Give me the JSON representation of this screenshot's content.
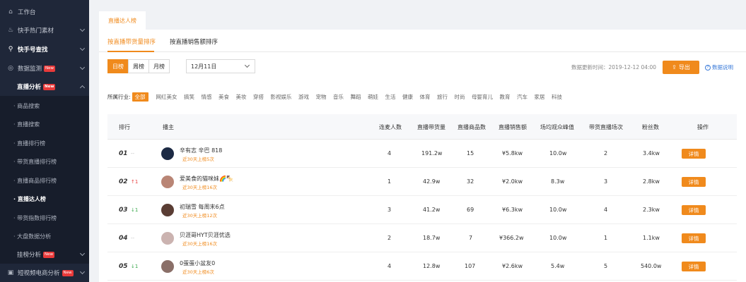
{
  "sidebar": {
    "items": [
      {
        "label": "工作台",
        "icon": "home-icon"
      },
      {
        "label": "快手热门素材",
        "icon": "fire-icon"
      },
      {
        "label": "快手号查找",
        "icon": "search-icon"
      },
      {
        "label": "数据监测",
        "icon": "monitor-icon",
        "badge": "New"
      },
      {
        "label": "直播分析",
        "badge": "New"
      }
    ],
    "sub_items": [
      {
        "label": "· 商品搜索"
      },
      {
        "label": "· 直播搜索"
      },
      {
        "label": "· 直播排行榜"
      },
      {
        "label": "· 带货直播排行榜"
      },
      {
        "label": "· 直播商品排行榜"
      },
      {
        "label": "· 直播达人榜"
      },
      {
        "label": "· 带货指数排行榜"
      },
      {
        "label": "· 大盘数据分析"
      }
    ],
    "bottom_items": [
      {
        "label": "挂榜分析",
        "badge": "New"
      },
      {
        "label": "短视频电商分析",
        "icon": "video-icon",
        "badge": "New"
      }
    ]
  },
  "page_tab": "直播达人榜",
  "subtabs": [
    "按直播带货量排序",
    "按直播销售额排序"
  ],
  "period_buttons": [
    "日榜",
    "周榜",
    "月榜"
  ],
  "date_select": "12月11日",
  "update_time": "数据更新时间：2019-12-12 04:00",
  "export_label": "导出",
  "help_label": "数据说明",
  "industry": {
    "label": "所属行业:",
    "options": [
      "全部",
      "网红美女",
      "搞笑",
      "情感",
      "美食",
      "美妆",
      "穿搭",
      "影视娱乐",
      "游戏",
      "宠物",
      "音乐",
      "舞蹈",
      "萌娃",
      "生活",
      "健康",
      "体育",
      "旅行",
      "时尚",
      "母婴育儿",
      "教育",
      "汽车",
      "家居",
      "科技"
    ]
  },
  "table": {
    "headers": [
      "排行",
      "播主",
      "连麦人数",
      "直播带货量",
      "直播商品数",
      "直播销售额",
      "场均观众峰值",
      "带货直播场次",
      "粉丝数",
      "操作"
    ],
    "rows": [
      {
        "rank": "01",
        "trend": "--",
        "trend_type": "flat",
        "name": "辛有志 辛巴 818",
        "note": "近30天上榜5次",
        "lianmai": "4",
        "sales_volume": "191.2w",
        "goods": "15",
        "revenue": "¥5.8kw",
        "peak": "10.0w",
        "sessions": "2",
        "fans": "3.4kw",
        "action": "详情",
        "avatar_color": "#1c2a44"
      },
      {
        "rank": "02",
        "trend": "↑1",
        "trend_type": "up",
        "name": "爱美食的猫咪妹🌈🍢",
        "note": "近30天上榜16次",
        "lianmai": "1",
        "sales_volume": "42.9w",
        "goods": "32",
        "revenue": "¥2.0kw",
        "peak": "8.3w",
        "sessions": "3",
        "fans": "2.8kw",
        "action": "详情",
        "avatar_color": "#b98575"
      },
      {
        "rank": "03",
        "trend": "↓1",
        "trend_type": "down",
        "name": "初瑞雪 每周末6点",
        "note": "近30天上榜12次",
        "lianmai": "3",
        "sales_volume": "41.2w",
        "goods": "69",
        "revenue": "¥6.3kw",
        "peak": "10.0w",
        "sessions": "4",
        "fans": "2.3kw",
        "action": "详情",
        "avatar_color": "#5a3d34"
      },
      {
        "rank": "04",
        "trend": "--",
        "trend_type": "flat",
        "name": "贝涯哥HYT贝涯优选",
        "note": "近30天上榜16次",
        "lianmai": "2",
        "sales_volume": "18.7w",
        "goods": "7",
        "revenue": "¥366.2w",
        "peak": "10.0w",
        "sessions": "1",
        "fans": "1.1kw",
        "action": "详情",
        "avatar_color": "#cbb3b0"
      },
      {
        "rank": "05",
        "trend": "↓1",
        "trend_type": "down",
        "name": "0蛋蛋小盆友0",
        "note": "近30天上榜6次",
        "lianmai": "4",
        "sales_volume": "12.8w",
        "goods": "107",
        "revenue": "¥2.6kw",
        "peak": "5.4w",
        "sessions": "5",
        "fans": "540.0w",
        "action": "详情",
        "avatar_color": "#8a6f68"
      }
    ]
  }
}
